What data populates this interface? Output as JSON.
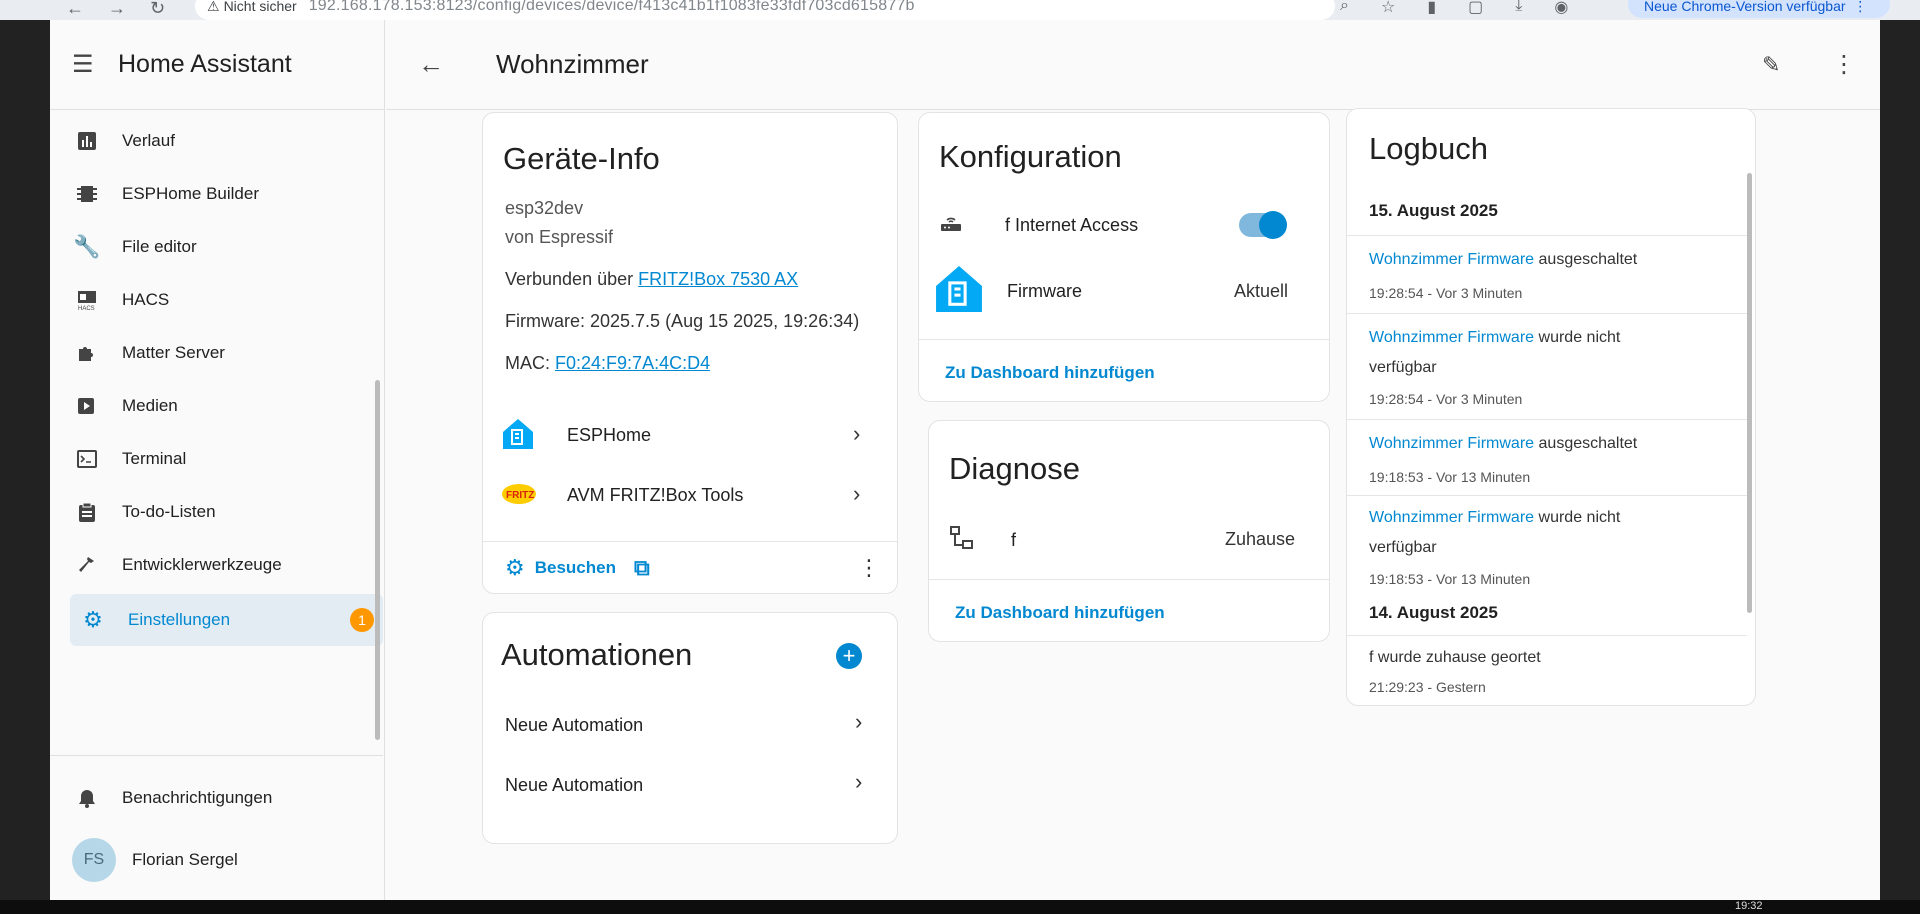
{
  "browser": {
    "security": "Nicht sicher",
    "url": "192.168.178.153:8123/config/devices/device/f413c41b1f1083fe33fdf703cd615877b",
    "update_chip": "Neue Chrome-Version verfügbar"
  },
  "sidebar": {
    "title": "Home Assistant",
    "items": [
      {
        "label": "Verlauf",
        "icon": "chart-icon"
      },
      {
        "label": "ESPHome Builder",
        "icon": "chip-icon"
      },
      {
        "label": "File editor",
        "icon": "wrench-icon"
      },
      {
        "label": "HACS",
        "icon": "hacs-icon"
      },
      {
        "label": "Matter Server",
        "icon": "puzzle-icon"
      },
      {
        "label": "Medien",
        "icon": "media-icon"
      },
      {
        "label": "Terminal",
        "icon": "terminal-icon"
      },
      {
        "label": "To-do-Listen",
        "icon": "clipboard-icon"
      },
      {
        "label": "Entwicklerwerkzeuge",
        "icon": "hammer-icon"
      },
      {
        "label": "Einstellungen",
        "icon": "gear-icon",
        "badge": "1"
      }
    ],
    "notifications": "Benachrichtigungen",
    "user": {
      "initials": "FS",
      "name": "Florian Sergel"
    }
  },
  "topbar": {
    "title": "Wohnzimmer"
  },
  "device_info": {
    "heading": "Geräte-Info",
    "model": "esp32dev",
    "manufacturer": "von Espressif",
    "connected_prefix": "Verbunden über",
    "connected_link": "FRITZ!Box 7530 AX",
    "firmware": "Firmware: 2025.7.5 (Aug 15 2025, 19:26:34)",
    "mac_prefix": "MAC:",
    "mac_link": "F0:24:F9:7A:4C:D4",
    "integrations": [
      "ESPHome",
      "AVM FRITZ!Box Tools"
    ],
    "visit": "Besuchen"
  },
  "automations": {
    "heading": "Automationen",
    "items": [
      "Neue Automation",
      "Neue Automation"
    ]
  },
  "config": {
    "heading": "Konfiguration",
    "internet": "f Internet Access",
    "firmware_label": "Firmware",
    "firmware_state": "Aktuell",
    "add_dashboard": "Zu Dashboard hinzufügen"
  },
  "diagnose": {
    "heading": "Diagnose",
    "entity": "f",
    "state": "Zuhause",
    "add_dashboard": "Zu Dashboard hinzufügen"
  },
  "logbook": {
    "heading": "Logbuch",
    "date1": "15. August 2025",
    "entries": [
      {
        "entity": "Wohnzimmer Firmware",
        "action": "ausgeschaltet",
        "time": "19:28:54 - Vor 3 Minuten"
      },
      {
        "entity": "Wohnzimmer Firmware",
        "action": "wurde nicht verfügbar",
        "time": "19:28:54 - Vor 3 Minuten"
      },
      {
        "entity": "Wohnzimmer Firmware",
        "action": "ausgeschaltet",
        "time": "19:18:53 - Vor 13 Minuten"
      },
      {
        "entity": "Wohnzimmer Firmware",
        "action": "wurde nicht verfügbar",
        "time": "19:18:53 - Vor 13 Minuten"
      }
    ],
    "date2": "14. August 2025",
    "entry5": {
      "text": "f wurde zuhause geortet",
      "time": "21:29:23 - Gestern"
    }
  },
  "taskbar": {
    "clock": "19:32"
  },
  "colors": {
    "accent": "#0288d1",
    "badge": "#ff9800"
  }
}
